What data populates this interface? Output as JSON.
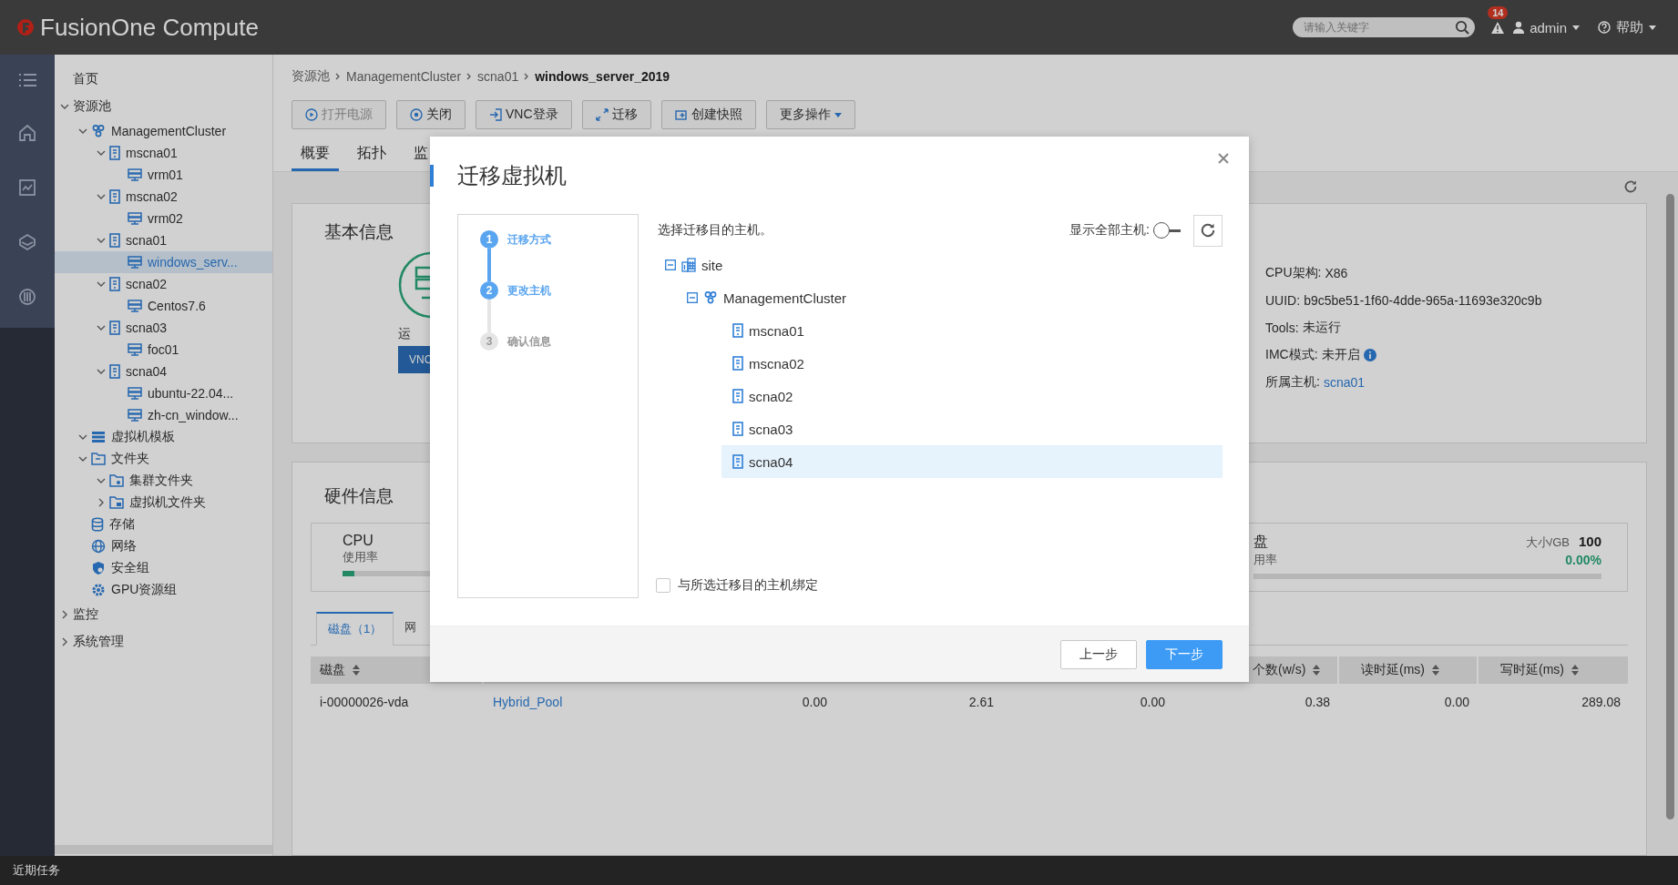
{
  "app": {
    "title": "FusionOne Compute"
  },
  "header": {
    "search": {
      "placeholder": "请输入关键字"
    },
    "alerts": {
      "count": "14"
    },
    "user": {
      "label": "admin"
    },
    "help": {
      "label": "帮助"
    }
  },
  "rail": {
    "items": [
      {
        "kind": "menu"
      },
      {
        "kind": "home"
      },
      {
        "kind": "monitor"
      },
      {
        "kind": "layers"
      },
      {
        "kind": "gpu"
      }
    ]
  },
  "sidebar": {
    "items": [
      {
        "label": "首页",
        "selected": false
      },
      {
        "label": "资源池",
        "expanded": true,
        "selected": false,
        "children": [
          {
            "label": "ManagementCluster",
            "kind": "cluster",
            "expanded": true,
            "selected": false,
            "children": [
              {
                "label": "mscna01",
                "kind": "host",
                "expanded": true,
                "selected": false,
                "children": [
                  {
                    "label": "vrm01",
                    "kind": "vm",
                    "selected": false
                  }
                ]
              },
              {
                "label": "mscna02",
                "kind": "host",
                "expanded": true,
                "selected": false,
                "children": [
                  {
                    "label": "vrm02",
                    "kind": "vm",
                    "selected": false
                  }
                ]
              },
              {
                "label": "scna01",
                "kind": "host",
                "expanded": true,
                "selected": false,
                "children": [
                  {
                    "label": "windows_serv...",
                    "kind": "vm",
                    "selected": true
                  }
                ]
              },
              {
                "label": "scna02",
                "kind": "host",
                "expanded": true,
                "selected": false,
                "children": [
                  {
                    "label": "Centos7.6",
                    "kind": "vm",
                    "selected": false
                  }
                ]
              },
              {
                "label": "scna03",
                "kind": "host",
                "expanded": true,
                "selected": false,
                "children": [
                  {
                    "label": "foc01",
                    "kind": "vm",
                    "selected": false
                  }
                ]
              },
              {
                "label": "scna04",
                "kind": "host",
                "expanded": true,
                "selected": false,
                "children": [
                  {
                    "label": "ubuntu-22.04...",
                    "kind": "vm",
                    "selected": false
                  },
                  {
                    "label": "zh-cn_window...",
                    "kind": "vm",
                    "selected": false
                  }
                ]
              }
            ]
          },
          {
            "label": "虚拟机模板",
            "kind": "template",
            "expanded": true,
            "selected": false
          },
          {
            "label": "文件夹",
            "kind": "folder",
            "expanded": true,
            "selected": false,
            "children": [
              {
                "label": "集群文件夹",
                "kind": "folder-cluster",
                "expanded": true,
                "selected": false
              },
              {
                "label": "虚拟机文件夹",
                "kind": "folder-vm",
                "expanded": false,
                "selected": false
              }
            ]
          },
          {
            "label": "存储",
            "kind": "storage",
            "selected": false
          },
          {
            "label": "网络",
            "kind": "network",
            "selected": false
          },
          {
            "label": "安全组",
            "kind": "security",
            "selected": false
          },
          {
            "label": "GPU资源组",
            "kind": "gpu",
            "selected": false
          }
        ]
      },
      {
        "label": "监控",
        "expanded": false,
        "selected": false
      },
      {
        "label": "系统管理",
        "expanded": false,
        "selected": false
      }
    ]
  },
  "breadcrumb": [
    "资源池",
    "ManagementCluster",
    "scna01",
    "windows_server_2019"
  ],
  "toolbar": [
    {
      "label": "打开电源",
      "kind": "power",
      "disabled": true
    },
    {
      "label": "关闭",
      "kind": "stop",
      "disabled": false
    },
    {
      "label": "VNC登录",
      "kind": "login",
      "disabled": false
    },
    {
      "label": "迁移",
      "kind": "migrate",
      "disabled": false
    },
    {
      "label": "创建快照",
      "kind": "snapshot",
      "disabled": false
    },
    {
      "label": "更多操作",
      "kind": "dropdown",
      "disabled": false
    }
  ],
  "tabs": [
    {
      "label": "概要",
      "selected": true
    },
    {
      "label": "拓扑",
      "selected": false
    },
    {
      "label": "监",
      "selected": false
    }
  ],
  "basic_info": {
    "title": "基本信息",
    "status": "运",
    "vnc_button": "VNC",
    "fields": [
      {
        "label": "CPU架构:",
        "value": "X86",
        "kind": "text"
      },
      {
        "label": "UUID:",
        "value": "b9c5be51-1f60-4dde-965a-11693e320c9b",
        "kind": "text"
      },
      {
        "label": "Tools:",
        "value": "未运行",
        "kind": "text"
      },
      {
        "label": "IMC模式:",
        "value": "未开启",
        "kind": "info"
      },
      {
        "label": "所属主机:",
        "value": "scna01",
        "kind": "link"
      }
    ]
  },
  "hardware": {
    "title": "硬件信息",
    "cards": [
      {
        "name": "CPU",
        "usage_label": "使用率",
        "level": 0.03
      },
      {
        "name": "盘",
        "usage_label": "用率",
        "size_label": "大小/GB",
        "size": "100",
        "percent": "0.00%"
      }
    ],
    "tabs": [
      {
        "label": "磁盘（1）",
        "selected": true
      },
      {
        "label": "网",
        "selected": false
      }
    ],
    "table": {
      "columns": [
        {
          "label": "磁盘"
        },
        {
          "label": "个数(w/s)"
        },
        {
          "label": "读时延(ms)"
        },
        {
          "label": "写时延(ms)"
        }
      ],
      "rows": [
        {
          "cells": [
            {
              "text": "i-00000026-vda"
            },
            {
              "text": "Hybrid_Pool",
              "kind": "link"
            },
            {
              "text": "0.00"
            },
            {
              "text": "2.61"
            },
            {
              "text": "0.00"
            },
            {
              "text": "0.38"
            },
            {
              "text": "0.00"
            },
            {
              "text": "289.08"
            }
          ]
        }
      ]
    }
  },
  "dialog": {
    "title": "迁移虚拟机",
    "steps": [
      {
        "number": "1",
        "label": "迁移方式",
        "reached": true
      },
      {
        "number": "2",
        "label": "更改主机",
        "reached": true
      },
      {
        "number": "3",
        "label": "确认信息",
        "reached": false
      }
    ],
    "prompt": "选择迁移目的主机。",
    "show_all": {
      "label": "显示全部主机:",
      "on": false
    },
    "tree": [
      {
        "label": "site",
        "kind": "site",
        "expanded": true,
        "selected": false,
        "children": [
          {
            "label": "ManagementCluster",
            "kind": "cluster",
            "expanded": true,
            "selected": false,
            "children": [
              {
                "label": "mscna01",
                "kind": "host",
                "selected": false
              },
              {
                "label": "mscna02",
                "kind": "host",
                "selected": false
              },
              {
                "label": "scna02",
                "kind": "host",
                "selected": false
              },
              {
                "label": "scna03",
                "kind": "host",
                "selected": false
              },
              {
                "label": "scna04",
                "kind": "host",
                "selected": true
              }
            ]
          }
        ]
      }
    ],
    "bind": {
      "label": "与所选迁移目的主机绑定",
      "checked": false
    },
    "buttons": [
      {
        "label": "上一步",
        "kind": "secondary"
      },
      {
        "label": "下一步",
        "kind": "primary"
      }
    ]
  },
  "status_bar": {
    "label": "近期任务"
  }
}
